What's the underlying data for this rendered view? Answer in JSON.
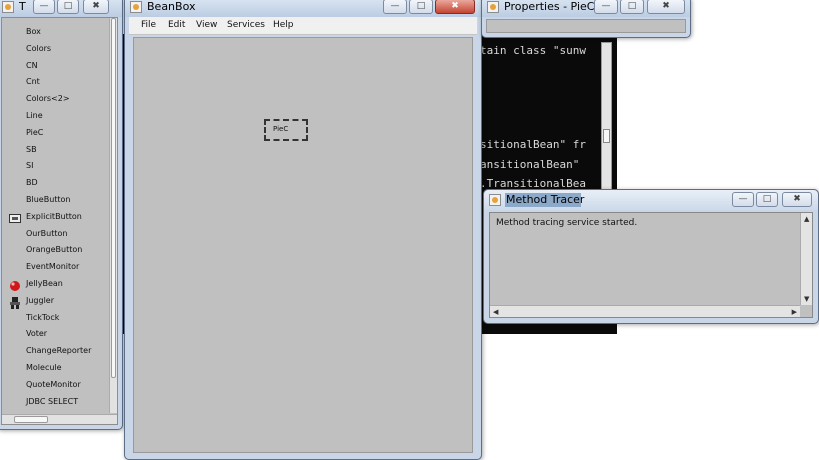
{
  "console": {
    "lines": [
      "tain class \"sunw",
      "sitionalBean\" fr",
      "ansitionalBean\"",
      ".TransitionalBea"
    ]
  },
  "toolbox": {
    "title": "T",
    "items": [
      {
        "label": "Box",
        "icon": ""
      },
      {
        "label": "Colors",
        "icon": ""
      },
      {
        "label": "CN",
        "icon": ""
      },
      {
        "label": "Cnt",
        "icon": ""
      },
      {
        "label": "Colors<2>",
        "icon": ""
      },
      {
        "label": "Line",
        "icon": ""
      },
      {
        "label": "PieC",
        "icon": ""
      },
      {
        "label": "SB",
        "icon": ""
      },
      {
        "label": "SI",
        "icon": ""
      },
      {
        "label": "BD",
        "icon": ""
      },
      {
        "label": "BlueButton",
        "icon": ""
      },
      {
        "label": "ExplicitButton",
        "icon": "button-icon"
      },
      {
        "label": "OurButton",
        "icon": ""
      },
      {
        "label": "OrangeButton",
        "icon": ""
      },
      {
        "label": "EventMonitor",
        "icon": ""
      },
      {
        "label": "JellyBean",
        "icon": "jellybean-icon"
      },
      {
        "label": "Juggler",
        "icon": "juggler-icon"
      },
      {
        "label": "TickTock",
        "icon": ""
      },
      {
        "label": "Voter",
        "icon": ""
      },
      {
        "label": "ChangeReporter",
        "icon": ""
      },
      {
        "label": "Molecule",
        "icon": ""
      },
      {
        "label": "QuoteMonitor",
        "icon": ""
      },
      {
        "label": "JDBC SELECT",
        "icon": ""
      }
    ]
  },
  "beanbox": {
    "title": "BeanBox",
    "menu": [
      "File",
      "Edit",
      "View",
      "Services",
      "Help"
    ],
    "bean_label": "PieC"
  },
  "properties": {
    "title": "Properties - PieC"
  },
  "tracer": {
    "title": "Method Tracer",
    "message": "Method tracing service started."
  },
  "colors": {
    "panel": "#c0c0c0",
    "console_bg": "#0a0a0a",
    "titlebar": "#c8d6e8",
    "close_button": "#c54534"
  }
}
